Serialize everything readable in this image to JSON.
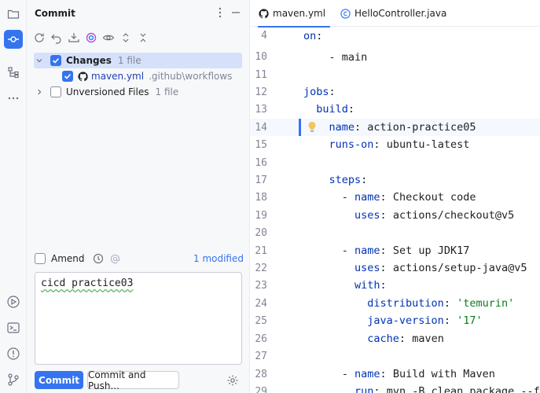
{
  "commit_panel": {
    "title": "Commit",
    "toolbar_icons": [
      "refresh-icon",
      "rollback-icon",
      "download-icon",
      "ai-icon",
      "eye-icon",
      "expand-icon",
      "collapse-icon"
    ],
    "changes": {
      "label": "Changes",
      "count": "1 file"
    },
    "file": {
      "name": "maven.yml",
      "path": ".github\\workflows"
    },
    "unversioned": {
      "label": "Unversioned Files",
      "count": "1 file"
    },
    "amend_label": "Amend",
    "modified_link": "1 modified",
    "message": "cicd practice03",
    "commit_button": "Commit",
    "commit_push_button": "Commit and Push..."
  },
  "editor": {
    "tabs": [
      {
        "label": "maven.yml",
        "active": true
      },
      {
        "label": "HelloController.java",
        "active": false
      }
    ],
    "lines": [
      {
        "num": "4",
        "code": "on:"
      },
      {
        "num": "10",
        "code": "    - main"
      },
      {
        "num": "11",
        "code": ""
      },
      {
        "num": "12",
        "code": "jobs:"
      },
      {
        "num": "13",
        "code": "  build:"
      },
      {
        "num": "14",
        "code": "    name: action-practice05"
      },
      {
        "num": "15",
        "code": "    runs-on: ubuntu-latest"
      },
      {
        "num": "16",
        "code": ""
      },
      {
        "num": "17",
        "code": "    steps:"
      },
      {
        "num": "18",
        "code": "      - name: Checkout code"
      },
      {
        "num": "19",
        "code": "        uses: actions/checkout@v5"
      },
      {
        "num": "20",
        "code": ""
      },
      {
        "num": "21",
        "code": "      - name: Set up JDK17"
      },
      {
        "num": "22",
        "code": "        uses: actions/setup-java@v5"
      },
      {
        "num": "23",
        "code": "        with:"
      },
      {
        "num": "24",
        "code": "          distribution: 'temurin'"
      },
      {
        "num": "25",
        "code": "          java-version: '17'"
      },
      {
        "num": "26",
        "code": "          cache: maven"
      },
      {
        "num": "27",
        "code": ""
      },
      {
        "num": "28",
        "code": "      - name: Build with Maven"
      },
      {
        "num": "29",
        "code": "        run: mvn -B clean package --fil"
      }
    ]
  },
  "colors": {
    "accent": "#3574f0",
    "keyword": "#0033b3",
    "string": "#067d17"
  }
}
